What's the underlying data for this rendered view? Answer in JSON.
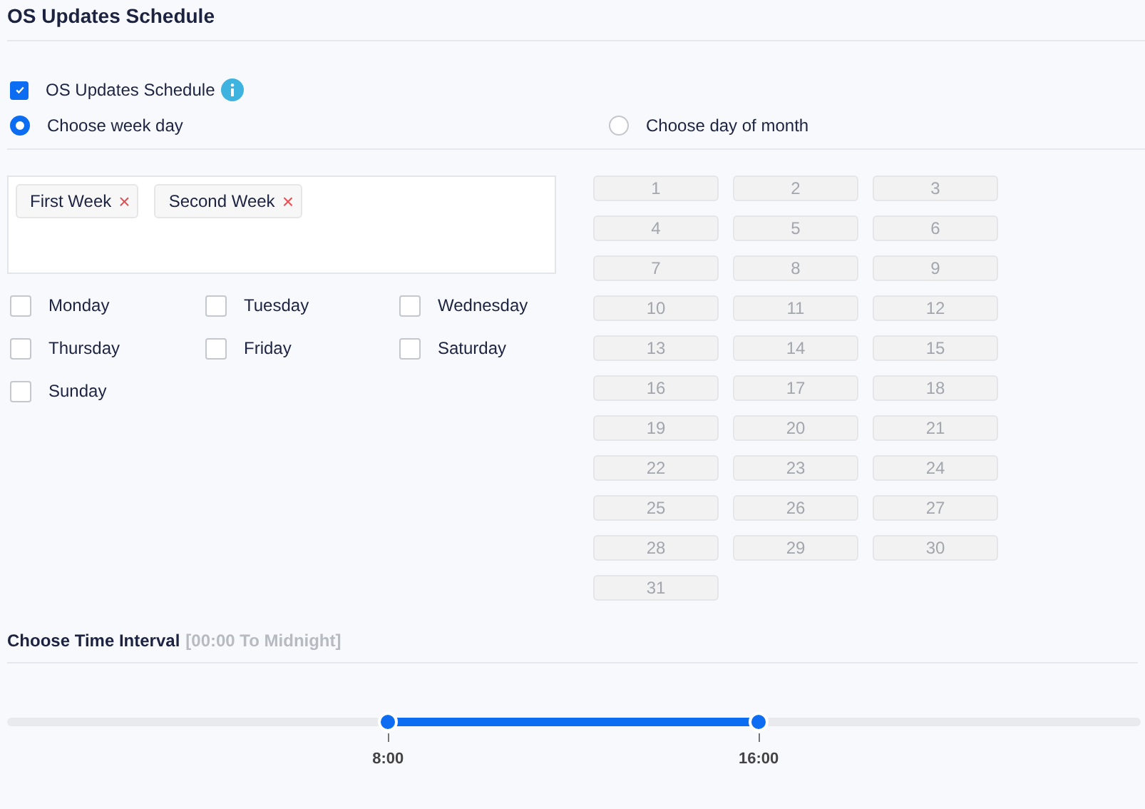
{
  "title": "OS Updates Schedule",
  "enable": {
    "label": "OS Updates Schedule",
    "checked": true
  },
  "modes": [
    {
      "label": "Choose week day",
      "selected": true
    },
    {
      "label": "Choose day of month",
      "selected": false
    }
  ],
  "week_tags": [
    {
      "label": "First Week",
      "remove": "×"
    },
    {
      "label": "Second Week",
      "remove": "×"
    }
  ],
  "weekdays": [
    {
      "label": "Monday",
      "checked": false
    },
    {
      "label": "Tuesday",
      "checked": false
    },
    {
      "label": "Wednesday",
      "checked": false
    },
    {
      "label": "Thursday",
      "checked": false
    },
    {
      "label": "Friday",
      "checked": false
    },
    {
      "label": "Saturday",
      "checked": false
    },
    {
      "label": "Sunday",
      "checked": false
    }
  ],
  "days_of_month": {
    "disabled": true,
    "days": [
      "1",
      "2",
      "3",
      "4",
      "5",
      "6",
      "7",
      "8",
      "9",
      "10",
      "11",
      "12",
      "13",
      "14",
      "15",
      "16",
      "17",
      "18",
      "19",
      "20",
      "21",
      "22",
      "23",
      "24",
      "25",
      "26",
      "27",
      "28",
      "29",
      "30",
      "31"
    ]
  },
  "time_interval": {
    "label": "Choose Time Interval",
    "hint": "[00:00 To Midnight]",
    "thumbs": [
      {
        "level": 0.336,
        "label": "8:00"
      },
      {
        "level": 0.663,
        "label": "16:00"
      }
    ]
  }
}
